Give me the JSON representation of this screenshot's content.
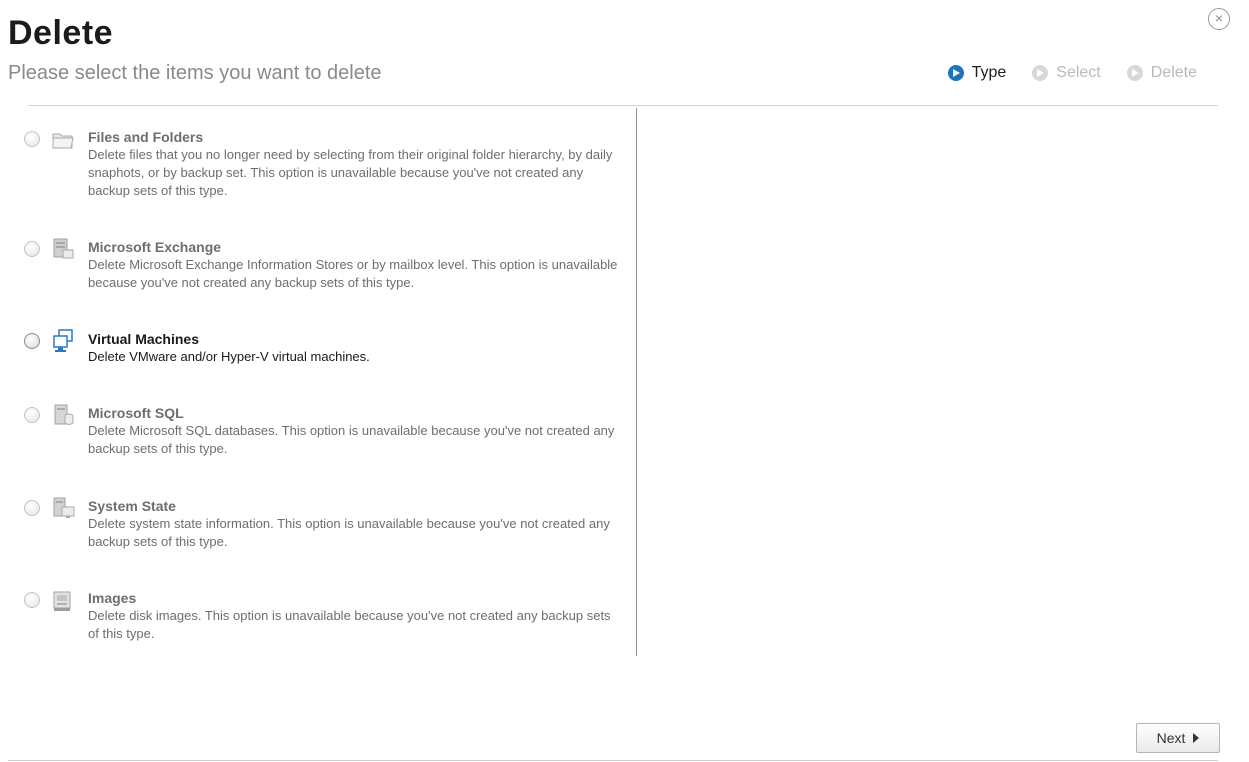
{
  "dialog": {
    "title": "Delete",
    "subtitle": "Please select the items you want to delete",
    "close_label": "×"
  },
  "steps": [
    {
      "label": "Type",
      "active": true
    },
    {
      "label": "Select",
      "active": false
    },
    {
      "label": "Delete",
      "active": false
    }
  ],
  "options": [
    {
      "name": "Files and Folders",
      "icon": "folder-icon",
      "enabled": false,
      "description": "Delete files that you no longer need by selecting from their original folder hierarchy, by daily snaphots, or by backup set. This option is unavailable because you've not created any backup sets of this type."
    },
    {
      "name": "Microsoft Exchange",
      "icon": "exchange-server-icon",
      "enabled": false,
      "description": "Delete Microsoft Exchange Information Stores or by mailbox level. This option is unavailable because you've not created any backup sets of this type."
    },
    {
      "name": "Virtual Machines",
      "icon": "virtual-machines-icon",
      "enabled": true,
      "description": "Delete VMware and/or Hyper-V virtual machines."
    },
    {
      "name": "Microsoft SQL",
      "icon": "sql-database-icon",
      "enabled": false,
      "description": "Delete Microsoft SQL databases. This option is unavailable because you've not created any backup sets of this type."
    },
    {
      "name": "System State",
      "icon": "system-state-icon",
      "enabled": false,
      "description": "Delete system state information. This option is unavailable because you've not created any backup sets of this type."
    },
    {
      "name": "Images",
      "icon": "disk-image-icon",
      "enabled": false,
      "description": "Delete disk images. This option is unavailable because you've not created any backup sets of this type."
    }
  ],
  "footer": {
    "next_label": "Next"
  }
}
